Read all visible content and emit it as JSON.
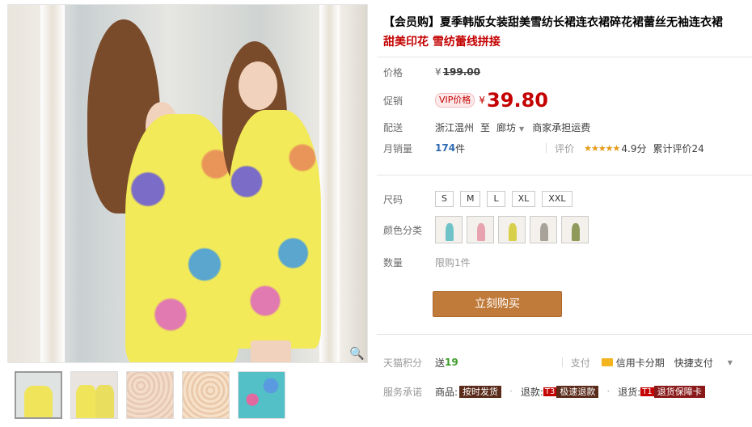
{
  "title": {
    "main": "【会员购】夏季韩版女装甜美雪纺长裙连衣裙碎花裙蕾丝无袖连衣裙",
    "sub": "甜美印花 雪纺蕾线拼接"
  },
  "price": {
    "label": "价格",
    "currency": "¥",
    "original": "199.00"
  },
  "promo": {
    "label": "促销",
    "tag": "VIP价格",
    "currency": "¥",
    "value": "39.80"
  },
  "delivery": {
    "label": "配送",
    "from": "浙江温州",
    "to_word": "至",
    "dest": "廊坊",
    "shipping": "商家承担运费"
  },
  "sales": {
    "label": "月销量",
    "count": "174",
    "unit": "件",
    "rating_label": "评价",
    "stars": "★★★★★",
    "score": "4.9分",
    "total": "累计评价24"
  },
  "size": {
    "label": "尺码",
    "options": [
      "S",
      "M",
      "L",
      "XL",
      "XXL"
    ]
  },
  "color": {
    "label": "颜色分类",
    "swatch_colors": [
      "#6fc3c8",
      "#e7a3b0",
      "#d8d04a",
      "#a7a39b",
      "#8f9a5a"
    ]
  },
  "quantity": {
    "label": "数量",
    "limit": "限购1件"
  },
  "buy_button": "立刻购买",
  "points": {
    "label": "天猫积分",
    "send": "送",
    "value": "19",
    "pay_label": "支付",
    "card": "信用卡分期",
    "quick": "快捷支付"
  },
  "service": {
    "label": "服务承诺",
    "goods": "商品:",
    "goods_tag": "按时发货",
    "refund": "退款:",
    "refund_num": "T3",
    "refund_tag": "极速退款",
    "return": "退货:",
    "return_num": "T1",
    "return_tag": "退货保障卡"
  }
}
